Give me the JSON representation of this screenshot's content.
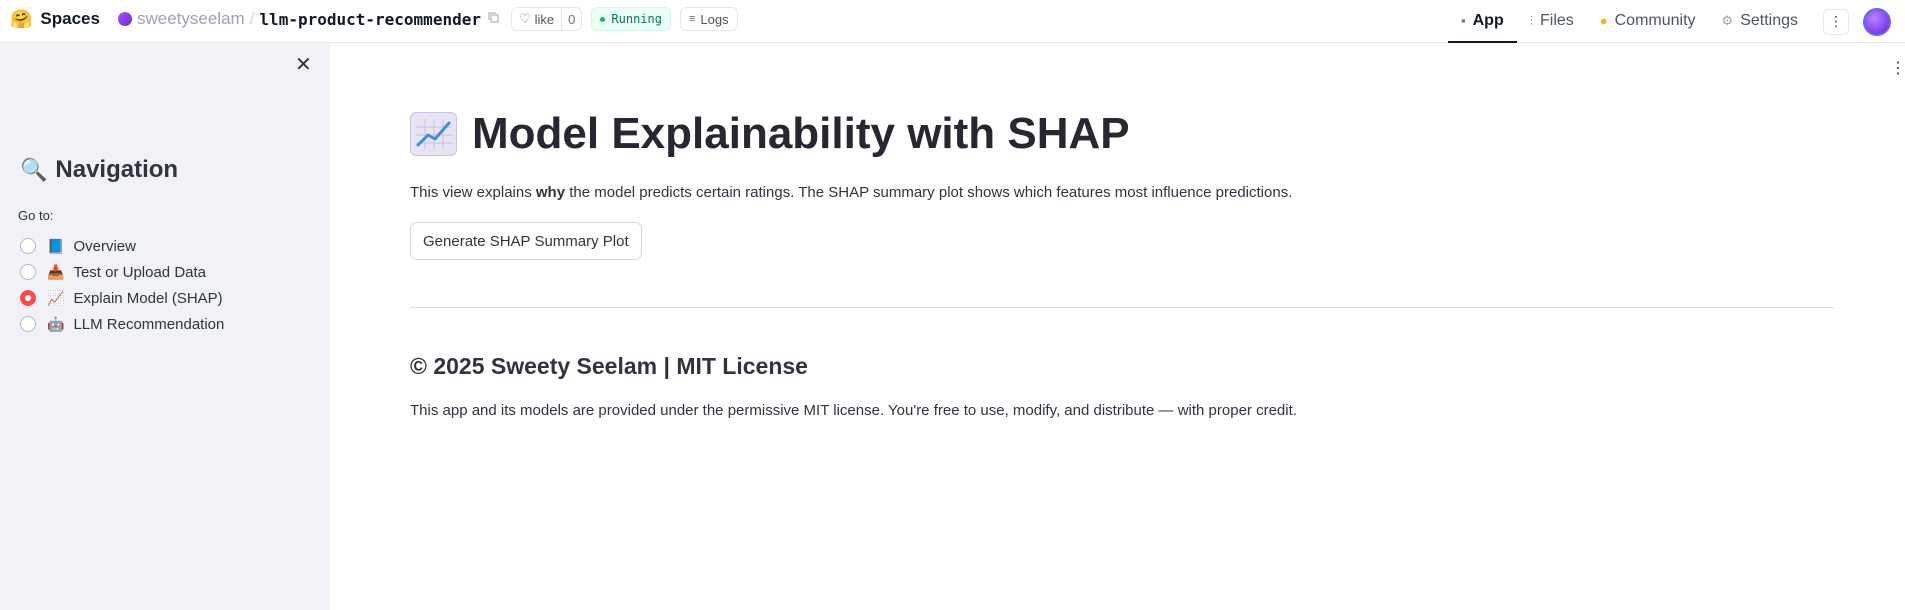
{
  "topbar": {
    "logo_icon": "🤗",
    "spaces_label": "Spaces",
    "owner": "sweetyseelam",
    "separator": "/",
    "repo": "llm-product-recommender",
    "like_label": "like",
    "like_count": "0",
    "status": "Running",
    "logs_label": "Logs",
    "tabs": [
      {
        "label": "App",
        "icon": "▪",
        "icon_name": "app-cube-icon",
        "active": true
      },
      {
        "label": "Files",
        "icon": "⫶",
        "icon_name": "files-icon",
        "active": false
      },
      {
        "label": "Community",
        "icon": "●",
        "icon_name": "community-icon",
        "active": false
      },
      {
        "label": "Settings",
        "icon": "⚙",
        "icon_name": "settings-gear-icon",
        "active": false
      }
    ],
    "more_icon": "⋮"
  },
  "sidebar": {
    "close_icon": "✕",
    "title_icon": "🔍",
    "title": "Navigation",
    "goto_label": "Go to:",
    "options": [
      {
        "emoji": "📘",
        "label": "Overview",
        "selected": false
      },
      {
        "emoji": "📥",
        "label": "Test or Upload Data",
        "selected": false
      },
      {
        "emoji": "📈",
        "label": "Explain Model (SHAP)",
        "selected": true
      },
      {
        "emoji": "🤖",
        "label": "LLM Recommendation",
        "selected": false
      }
    ]
  },
  "main": {
    "menu_icon": "⋮",
    "title_icon": "📈",
    "title": "Model Explainability with SHAP",
    "desc_pre": "This view explains ",
    "desc_bold": "why",
    "desc_post": " the model predicts certain ratings. The SHAP summary plot shows which features most influence predictions.",
    "button_label": "Generate SHAP Summary Plot",
    "footer_title": "© 2025 Sweety Seelam | MIT License",
    "footer_text": "This app and its models are provided under the permissive MIT license. You're free to use, modify, and distribute — with proper credit."
  },
  "colors": {
    "sidebar_bg": "#f0f2f6",
    "accent_radio": "#ff4b4b",
    "running_green": "#047857"
  }
}
